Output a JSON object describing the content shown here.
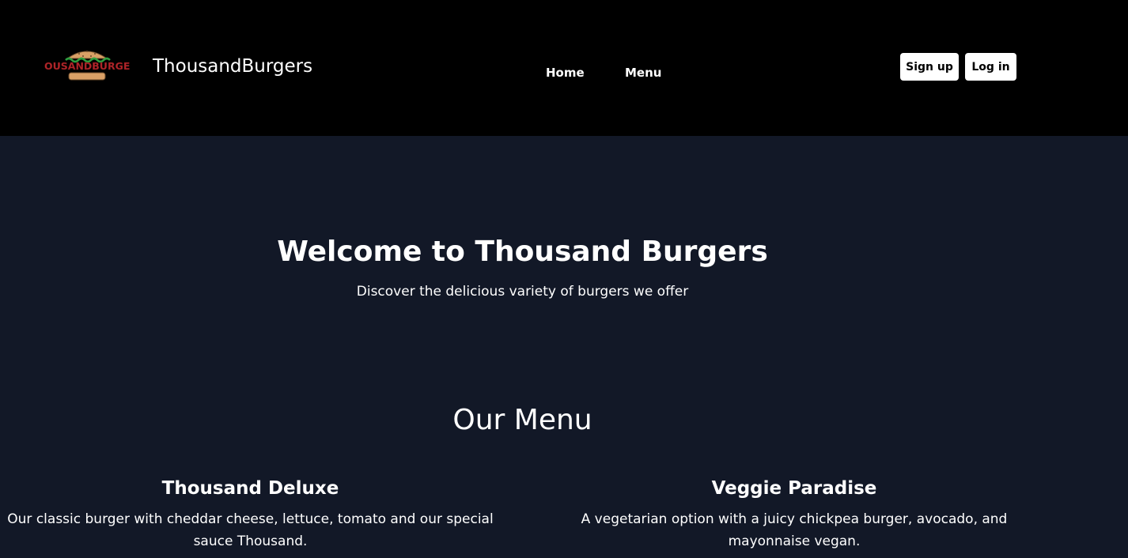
{
  "header": {
    "logo_text": "THOUSANDBURGERS",
    "brand": "ThousandBurgers",
    "nav": [
      {
        "label": "Home"
      },
      {
        "label": "Menu"
      }
    ],
    "signup_label": "Sign up",
    "login_label": "Log in"
  },
  "hero": {
    "title": "Welcome to Thousand Burgers",
    "subtitle": "Discover the delicious variety of burgers we offer"
  },
  "menu": {
    "title": "Our Menu",
    "items": [
      {
        "name": "Thousand Deluxe",
        "description": "Our classic burger with cheddar cheese, lettuce, tomato and our special sauce Thousand."
      },
      {
        "name": "Veggie Paradise",
        "description": "A vegetarian option with a juicy chickpea burger, avocado, and mayonnaise vegan."
      }
    ]
  },
  "colors": {
    "header_bg": "#000000",
    "page_bg": "#121827",
    "logo_text": "#b3262b",
    "bun": "#d9a066",
    "lettuce": "#2e9e3f"
  }
}
